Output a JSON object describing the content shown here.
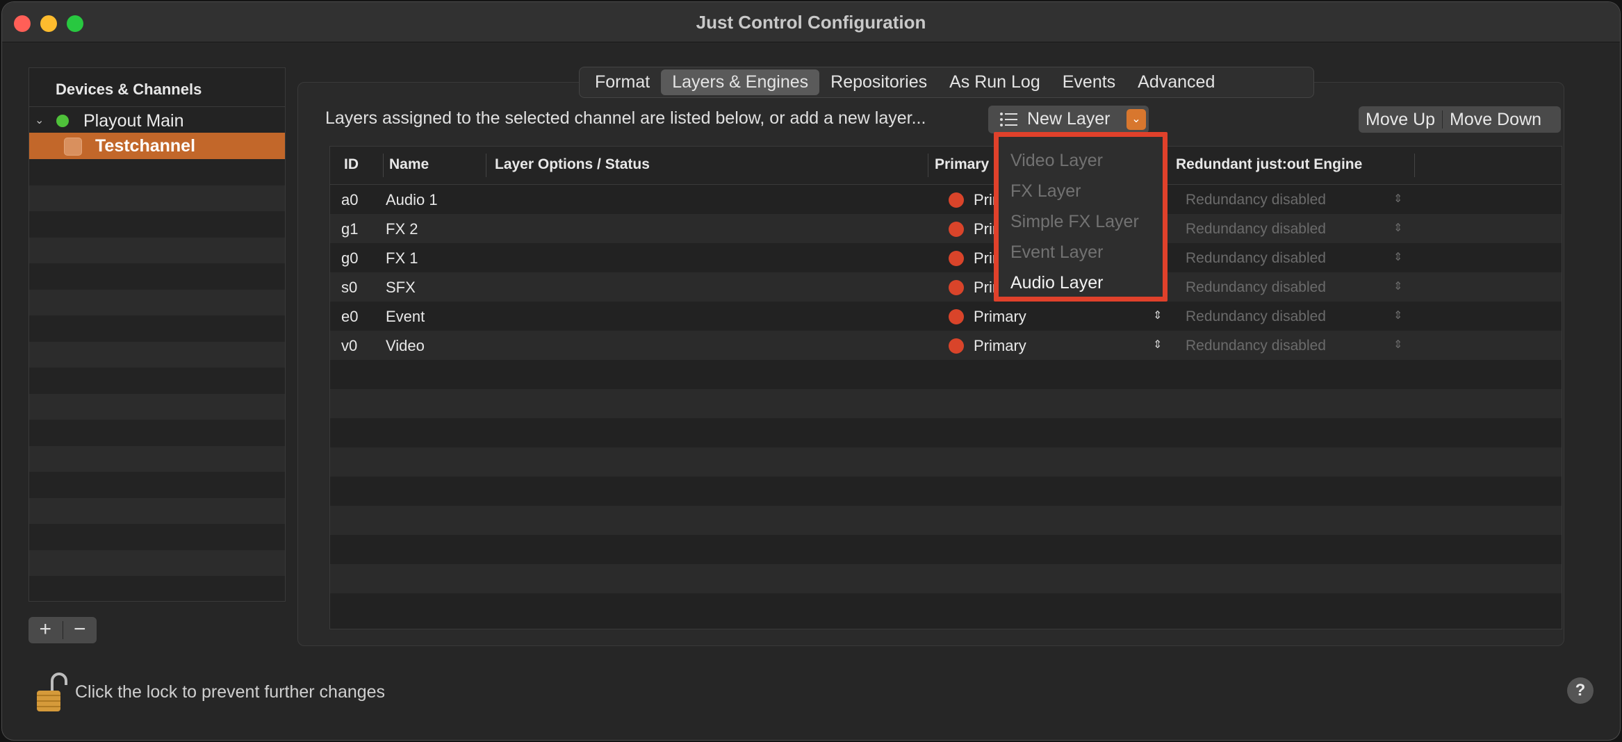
{
  "window": {
    "title": "Just Control Configuration"
  },
  "sidebar": {
    "header": "Devices & Channels",
    "device": {
      "label": "Playout Main",
      "status_color": "#4fc13a"
    },
    "channel": {
      "label": "Testchannel",
      "highlight_color": "#c2672a"
    },
    "add_label": "+",
    "remove_label": "−"
  },
  "tabs": [
    {
      "label": "Format",
      "active": false
    },
    {
      "label": "Layers & Engines",
      "active": true
    },
    {
      "label": "Repositories",
      "active": false
    },
    {
      "label": "As Run Log",
      "active": false
    },
    {
      "label": "Events",
      "active": false
    },
    {
      "label": "Advanced",
      "active": false
    }
  ],
  "main": {
    "intro_text": "Layers assigned to the selected channel are listed below, or add a new layer...",
    "new_layer_label": "New Layer",
    "move_up_label": "Move Up",
    "move_down_label": "Move Down"
  },
  "table": {
    "columns": [
      "ID",
      "Name",
      "Layer Options / Status",
      "Primary",
      "Redundant just:out Engine"
    ],
    "rows": [
      {
        "id": "a0",
        "name": "Audio 1",
        "primary": "Primary",
        "redundant": "Redundancy disabled"
      },
      {
        "id": "g1",
        "name": "FX 2",
        "primary": "Primary",
        "redundant": "Redundancy disabled"
      },
      {
        "id": "g0",
        "name": "FX 1",
        "primary": "Primary",
        "redundant": "Redundancy disabled"
      },
      {
        "id": "s0",
        "name": "SFX",
        "primary": "Primary",
        "redundant": "Redundancy disabled"
      },
      {
        "id": "e0",
        "name": "Event",
        "primary": "Primary",
        "redundant": "Redundancy disabled"
      },
      {
        "id": "v0",
        "name": "Video",
        "primary": "Primary",
        "redundant": "Redundancy disabled"
      }
    ],
    "status_color": "#d9442a"
  },
  "menu": {
    "items": [
      {
        "label": "Video Layer",
        "enabled": false
      },
      {
        "label": "FX Layer",
        "enabled": false
      },
      {
        "label": "Simple FX Layer",
        "enabled": false
      },
      {
        "label": "Event Layer",
        "enabled": false
      },
      {
        "label": "Audio Layer",
        "enabled": true
      }
    ],
    "highlight_border_color": "#e0412b"
  },
  "footer": {
    "lock_text": "Click the lock to prevent further changes",
    "help_label": "?"
  },
  "colors": {
    "accent": "#d8772e"
  }
}
